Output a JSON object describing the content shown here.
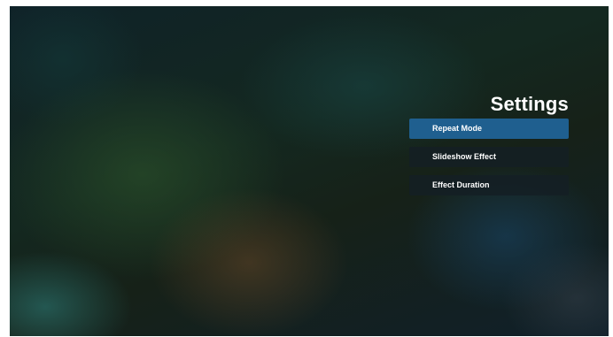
{
  "settings": {
    "title": "Settings",
    "items": [
      {
        "label": "Repeat Mode",
        "selected": true
      },
      {
        "label": "Slideshow Effect",
        "selected": false
      },
      {
        "label": "Effect Duration",
        "selected": false
      }
    ]
  },
  "colors": {
    "selected_item": "#1f5f8f",
    "item_background": "#141e24",
    "text": "#ffffff"
  }
}
